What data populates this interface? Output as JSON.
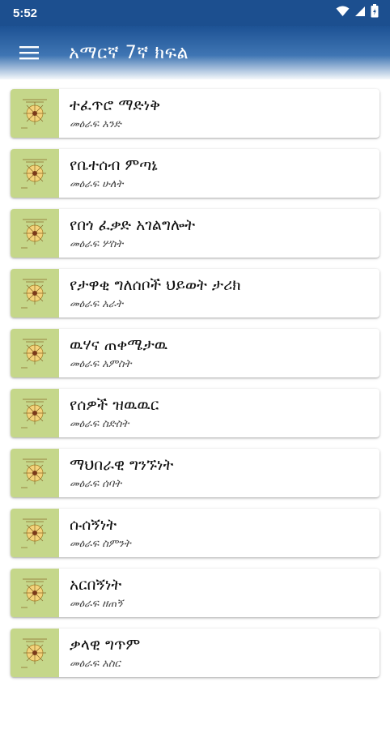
{
  "status_bar": {
    "time": "5:52",
    "icons": [
      "wifi-icon",
      "signal-icon",
      "battery-icon"
    ]
  },
  "app_bar": {
    "title": "አማርኛ 7ኛ ክፍል",
    "menu_icon": "menu-icon"
  },
  "colors": {
    "primary": "#1c4f8f",
    "thumb_bg": "#c5d78a"
  },
  "lessons": [
    {
      "title": "ተፈጥሮ ማድነቅ",
      "subtitle": "መዕራፍ አንድ"
    },
    {
      "title": "የቤተሰብ ምጣኔ",
      "subtitle": "መዕራፍ ሁለት"
    },
    {
      "title": "የበጎ ፈቃድ አገልግሎት",
      "subtitle": "መዕራፍ ሦስት"
    },
    {
      "title": "የታዋቂ ግለሰቦች ህይወት ታሪክ",
      "subtitle": "መዕራፍ አራት"
    },
    {
      "title": "ዉሃና ጠቀሜታዉ",
      "subtitle": "መዕራፍ አምስት"
    },
    {
      "title": "የሰዎች ዝዉዉር",
      "subtitle": "መዕራፍ ስድስት"
    },
    {
      "title": "ማህበራዊ ግንኙነት",
      "subtitle": "መዕራፍ ሰባት"
    },
    {
      "title": "ሱሰኝነት",
      "subtitle": "መዕራፍ ስምንት"
    },
    {
      "title": "አርበኝነት",
      "subtitle": "መዕራፍ ዘጠኝ"
    },
    {
      "title": "ቃላዊ ግጥም",
      "subtitle": "መዕራፍ አስር"
    }
  ]
}
